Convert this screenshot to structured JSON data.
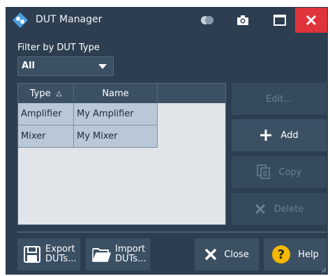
{
  "window": {
    "title": "DUT Manager"
  },
  "filter": {
    "label": "Filter by DUT Type",
    "selected": "All"
  },
  "table": {
    "columns": [
      {
        "label": "Type",
        "sort_glyph": "△"
      },
      {
        "label": "Name"
      }
    ],
    "rows": [
      {
        "type": "Amplifier",
        "name": "My Amplifier"
      },
      {
        "type": "Mixer",
        "name": "My Mixer"
      }
    ]
  },
  "actions": {
    "edit": "Edit...",
    "add": "Add",
    "copy": "Copy",
    "delete": "Delete"
  },
  "footer": {
    "export": [
      "Export",
      "DUTs..."
    ],
    "import": [
      "Import",
      "DUTs..."
    ],
    "close": "Close",
    "help": "Help"
  },
  "colors": {
    "background": "#2c3e50",
    "button": "#3c5064",
    "close_accent": "#e0343c",
    "help_accent": "#f5b800",
    "table_cell": "#b9c8d6"
  }
}
